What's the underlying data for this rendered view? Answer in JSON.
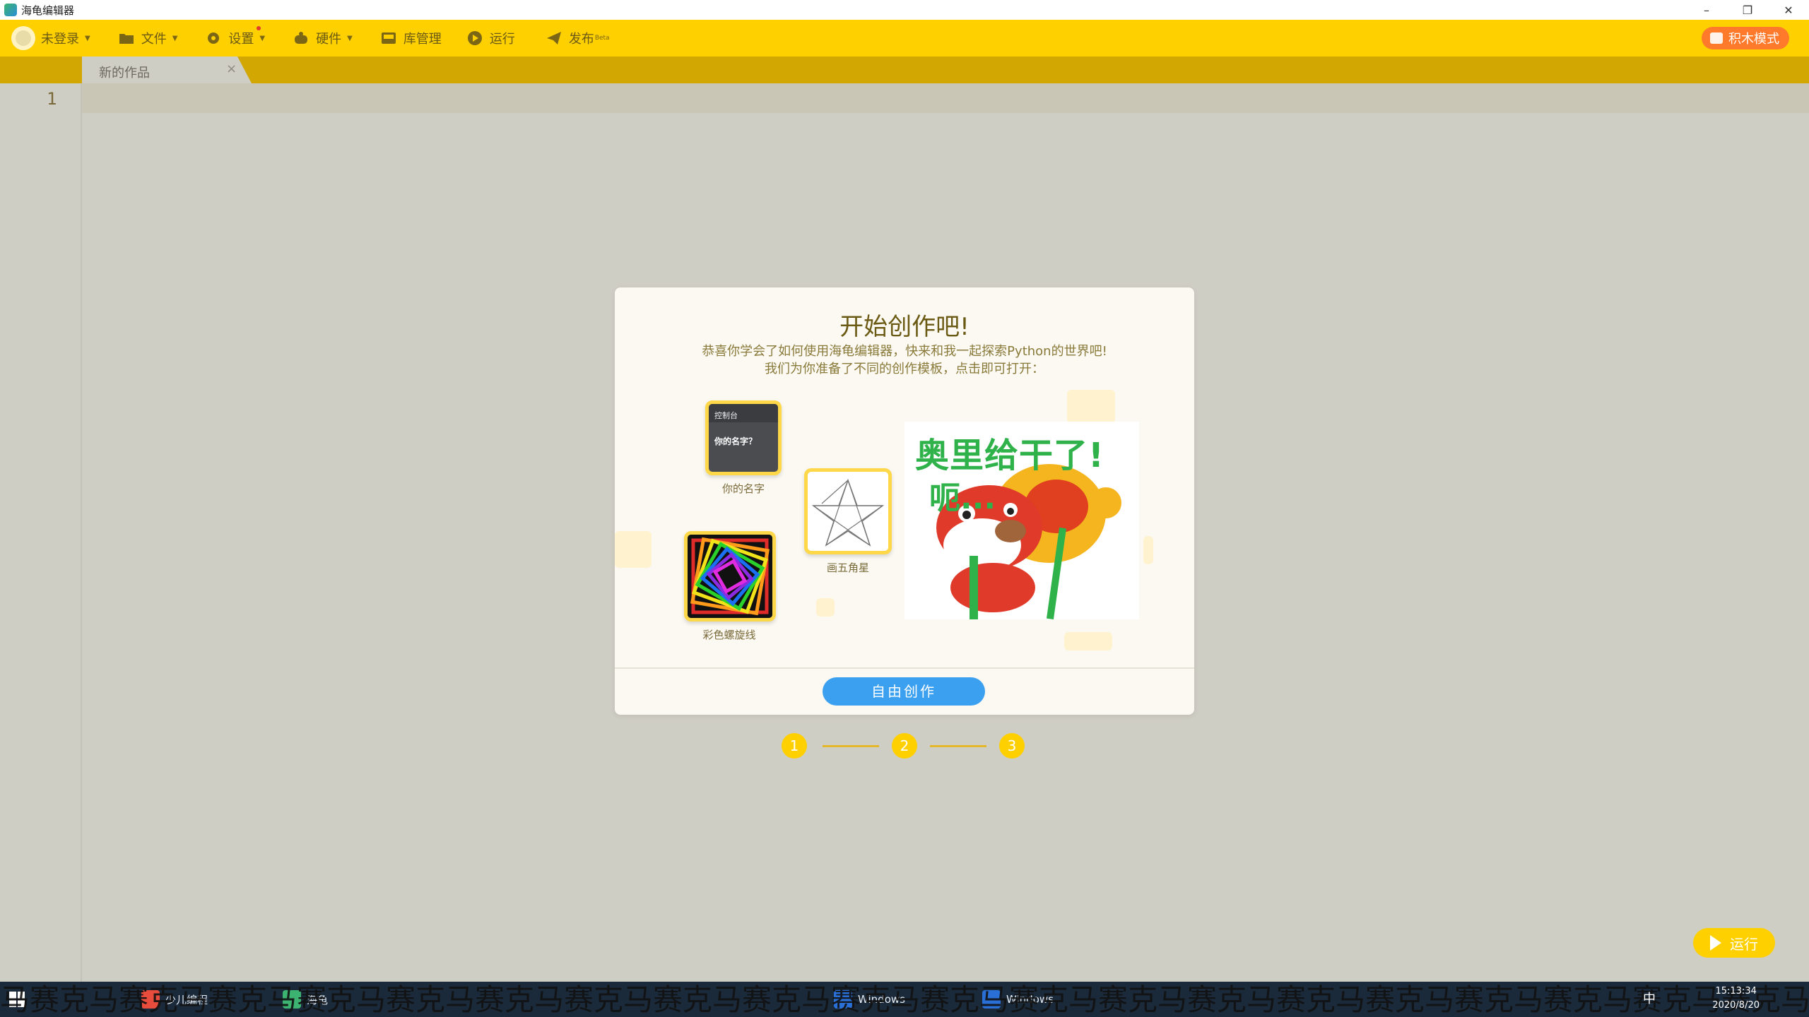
{
  "window": {
    "title": "海龟编辑器",
    "minimize": "–",
    "maximize": "❐",
    "close": "✕"
  },
  "menu": {
    "user": "未登录",
    "file": "文件",
    "settings": "设置",
    "hardware": "硬件",
    "library": "库管理",
    "run": "运行",
    "publish": "发布",
    "publish_badge": "Beta",
    "block_mode": "积木模式"
  },
  "tab": {
    "label": "新的作品",
    "close": "×"
  },
  "editor": {
    "line_number": "1"
  },
  "modal": {
    "title": "开始创作吧!",
    "desc1": "恭喜你学会了如何使用海龟编辑器，快来和我一起探索Python的世界吧!",
    "desc2": "我们为你准备了不同的创作模板，点击即可打开：",
    "templates": [
      {
        "caption": "你的名字",
        "console_title": "控制台",
        "console_text": "你的名字？"
      },
      {
        "caption": "画五角星"
      },
      {
        "caption": "彩色螺旋线"
      }
    ],
    "picture_text_1": "奥里给干了!",
    "picture_text_2": "呃...",
    "free_button": "自由创作"
  },
  "steps": [
    "1",
    "2",
    "3"
  ],
  "run_button": "运行",
  "taskbar": {
    "watermark": "马赛克马赛克马赛克马赛克马赛克马赛克马赛克马赛克马赛克马赛克马赛克马赛克马赛克马赛克马赛克马赛克马赛克马赛克马赛克马赛克马赛克马赛克马",
    "items": [
      "",
      "",
      "少儿编程",
      "海龟",
      "",
      "",
      "",
      "",
      "Windows",
      "Windows",
      ""
    ],
    "ime": "中",
    "time": "15:13:34",
    "date": "2020/8/20"
  },
  "colors": {
    "menubar": "#ffd000",
    "tabstrip": "#d2a702",
    "editor_bg": "#cfcec4",
    "button_blue": "#3ba0f0",
    "block_mode": "#ff7a2a"
  }
}
